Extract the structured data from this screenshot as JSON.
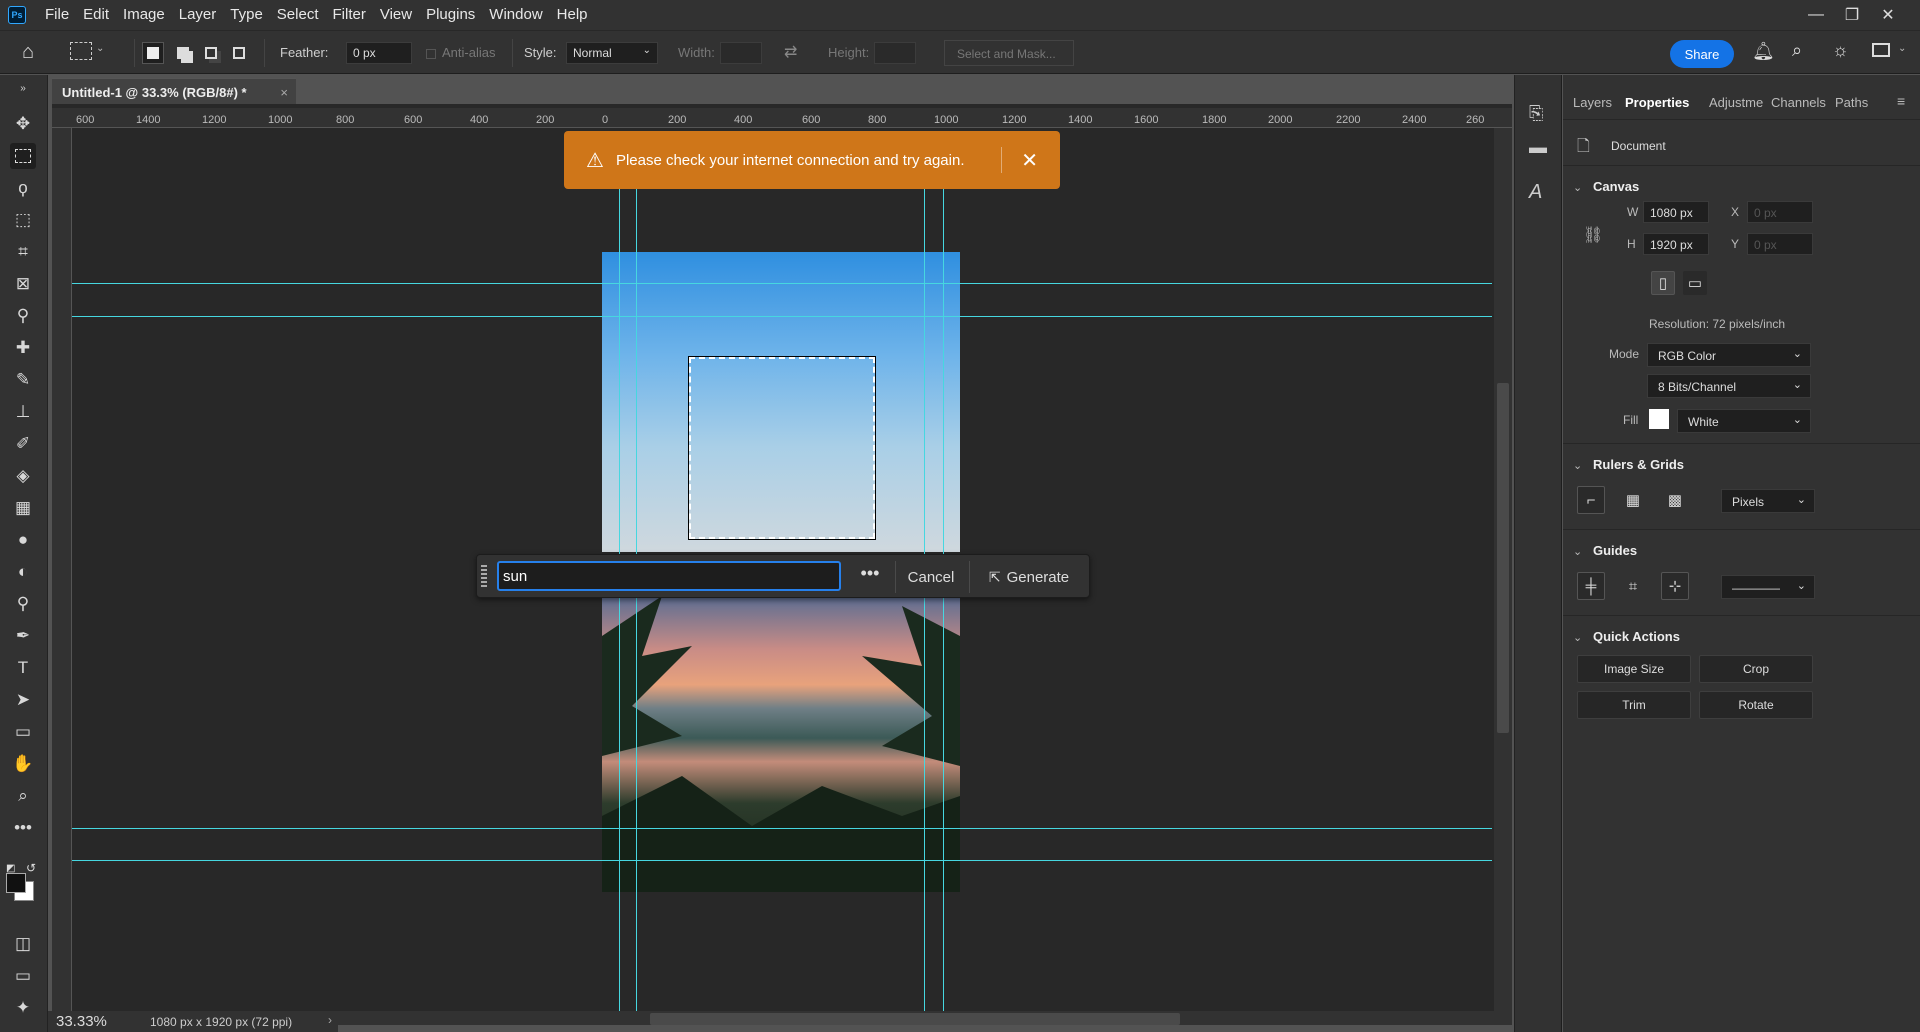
{
  "menubar": {
    "logo": "Ps",
    "items": [
      "File",
      "Edit",
      "Image",
      "Layer",
      "Type",
      "Select",
      "Filter",
      "View",
      "Plugins",
      "Window",
      "Help"
    ],
    "win_controls": {
      "minimize": "—",
      "restore": "❐",
      "close": "✕"
    }
  },
  "options": {
    "feather_label": "Feather:",
    "feather_value": "0 px",
    "antialias_label": "Anti-alias",
    "style_label": "Style:",
    "style_value": "Normal",
    "width_label": "Width:",
    "height_label": "Height:",
    "select_mask_label": "Select and Mask...",
    "share_label": "Share"
  },
  "document": {
    "tab_title": "Untitled-1 @ 33.3% (RGB/8#) *",
    "ruler_h": [
      "600",
      "1400",
      "1200",
      "1000",
      "800",
      "600",
      "400",
      "200",
      "0",
      "200",
      "400",
      "600",
      "800",
      "1000",
      "1200",
      "1400",
      "1600",
      "1800",
      "2000",
      "2200",
      "2400",
      "260"
    ],
    "zoom": "33.33%",
    "doc_info": "1080 px x 1920 px (72 ppi)"
  },
  "toast": {
    "message": "Please check your internet connection and try again.",
    "close": "✕"
  },
  "generative": {
    "prompt_value": "sun",
    "more": "•••",
    "cancel_label": "Cancel",
    "generate_label": "Generate"
  },
  "panel": {
    "tabs": [
      "Layers",
      "Properties",
      "Adjustme",
      "Channels",
      "Paths"
    ],
    "active_tab": "Properties",
    "document_label": "Document",
    "canvas": {
      "title": "Canvas",
      "w_label": "W",
      "w_value": "1080 px",
      "h_label": "H",
      "h_value": "1920 px",
      "x_label": "X",
      "x_value": "0 px",
      "y_label": "Y",
      "y_value": "0 px",
      "resolution": "Resolution: 72 pixels/inch",
      "mode_label": "Mode",
      "mode_value": "RGB Color",
      "bits_value": "8 Bits/Channel",
      "fill_label": "Fill",
      "fill_value": "White"
    },
    "rulers": {
      "title": "Rulers & Grids",
      "unit": "Pixels"
    },
    "guides": {
      "title": "Guides",
      "style": "————"
    },
    "quick_actions": {
      "title": "Quick Actions",
      "image_size": "Image Size",
      "crop": "Crop",
      "trim": "Trim",
      "rotate": "Rotate"
    }
  },
  "colors": {
    "accent": "#1473e6",
    "toast": "#cf7619",
    "guide": "#46d7e0"
  }
}
